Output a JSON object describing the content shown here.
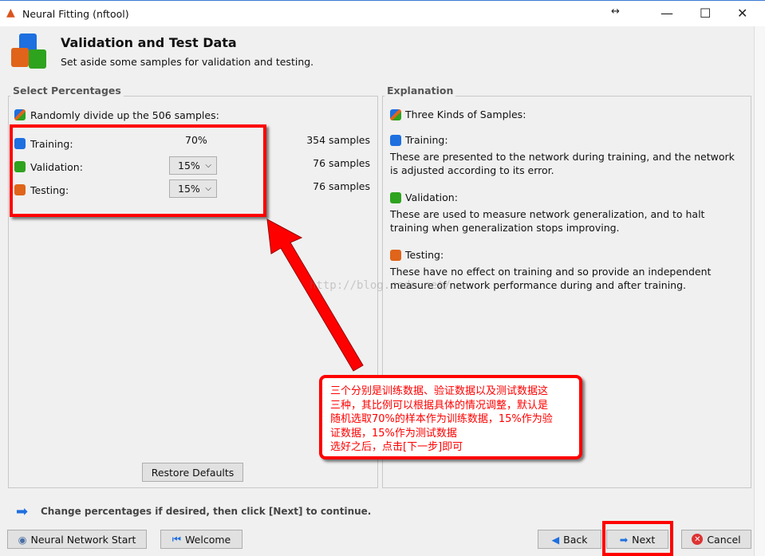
{
  "window": {
    "title": "Neural Fitting (nftool)",
    "resize_icon": "↔",
    "minimize": "—",
    "maximize": "☐",
    "close": "✕"
  },
  "header": {
    "title": "Validation and Test Data",
    "subtitle": "Set aside some samples for validation and testing."
  },
  "select_panel": {
    "legend": "Select Percentages",
    "intro": "Randomly divide up the 506 samples:",
    "rows": [
      {
        "label": "Training:",
        "value": "70%",
        "count": "354 samples",
        "color": "#1e6fe0"
      },
      {
        "label": "Validation:",
        "value": "15%",
        "count": "76 samples",
        "color": "#2ea31e"
      },
      {
        "label": "Testing:",
        "value": "15%",
        "count": "76 samples",
        "color": "#e0641a"
      }
    ],
    "restore_label": "Restore Defaults"
  },
  "explanation": {
    "legend": "Explanation",
    "intro": "Three Kinds of Samples:",
    "items": [
      {
        "title": "Training:",
        "text": "These are presented to the network during training, and the network is adjusted according to its error."
      },
      {
        "title": "Validation:",
        "text": "These are used to measure network generalization, and to halt training when generalization stops improving."
      },
      {
        "title": "Testing:",
        "text": "These have no effect on training and so provide an independent measure of network performance during and after training."
      }
    ]
  },
  "annotation": {
    "lines": [
      "三个分别是训练数据、验证数据以及测试数据这",
      "三种，其比例可以根据具体的情况调整，默认是",
      "随机选取70%的样本作为训练数据，15%作为验",
      "证数据，15%作为测试数据",
      "选好之后，点击[下一步]即可"
    ]
  },
  "watermark": "http://blog.csdn.net/",
  "hint": "Change percentages if desired, then click [Next] to continue.",
  "footer": {
    "nn_start": "Neural Network Start",
    "welcome": "Welcome",
    "back": "Back",
    "next": "Next",
    "cancel": "Cancel"
  }
}
